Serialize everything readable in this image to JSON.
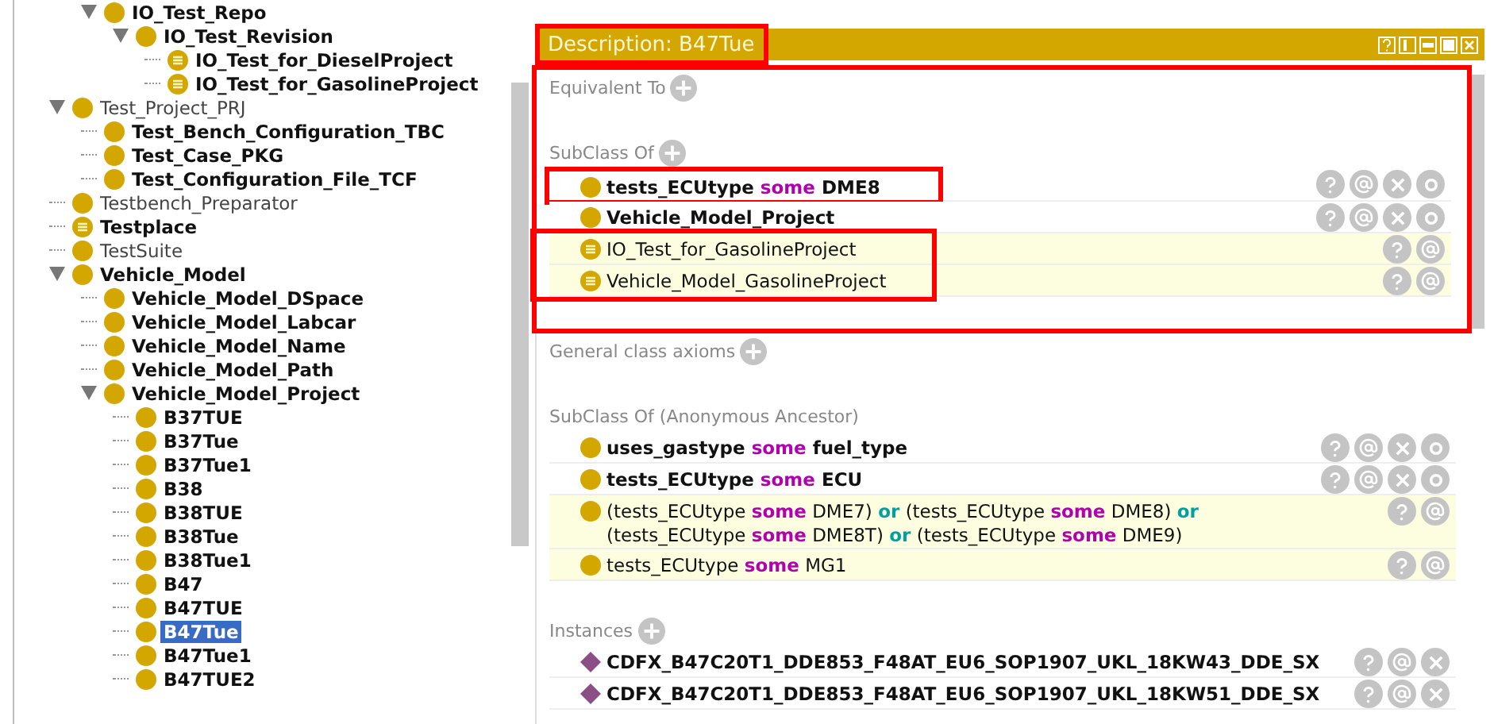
{
  "class_tree": {
    "continued_branch": [
      {
        "label": "IO_Test_Repo",
        "bold": true,
        "kind": "class",
        "expanded": true,
        "selected": false,
        "children": [
          {
            "label": "IO_Test_Revision",
            "bold": true,
            "kind": "class",
            "expanded": true,
            "selected": false,
            "children": [
              {
                "label": "IO_Test_for_DieselProject",
                "bold": true,
                "kind": "defined",
                "selected": false
              },
              {
                "label": "IO_Test_for_GasolineProject",
                "bold": true,
                "kind": "defined",
                "selected": false
              }
            ]
          }
        ]
      }
    ],
    "items": [
      {
        "label": "Test_Project_PRJ",
        "bold": false,
        "kind": "class",
        "expanded": true,
        "selected": false,
        "children": [
          {
            "label": "Test_Bench_Configuration_TBC",
            "bold": true,
            "kind": "class",
            "selected": false
          },
          {
            "label": "Test_Case_PKG",
            "bold": true,
            "kind": "class",
            "selected": false
          },
          {
            "label": "Test_Configuration_File_TCF",
            "bold": true,
            "kind": "class",
            "selected": false
          }
        ]
      },
      {
        "label": "Testbench_Preparator",
        "bold": false,
        "kind": "class",
        "selected": false
      },
      {
        "label": "Testplace",
        "bold": true,
        "kind": "defined",
        "selected": false
      },
      {
        "label": "TestSuite",
        "bold": false,
        "kind": "class",
        "selected": false
      },
      {
        "label": "Vehicle_Model",
        "bold": true,
        "kind": "class",
        "expanded": true,
        "selected": false,
        "children": [
          {
            "label": "Vehicle_Model_DSpace",
            "bold": true,
            "kind": "class",
            "selected": false
          },
          {
            "label": "Vehicle_Model_Labcar",
            "bold": true,
            "kind": "class",
            "selected": false
          },
          {
            "label": "Vehicle_Model_Name",
            "bold": true,
            "kind": "class",
            "selected": false
          },
          {
            "label": "Vehicle_Model_Path",
            "bold": true,
            "kind": "class",
            "selected": false
          },
          {
            "label": "Vehicle_Model_Project",
            "bold": true,
            "kind": "class",
            "expanded": true,
            "selected": false,
            "children": [
              {
                "label": "B37TUE",
                "bold": true,
                "kind": "class",
                "selected": false
              },
              {
                "label": "B37Tue",
                "bold": true,
                "kind": "class",
                "selected": false
              },
              {
                "label": "B37Tue1",
                "bold": true,
                "kind": "class",
                "selected": false
              },
              {
                "label": "B38",
                "bold": true,
                "kind": "class",
                "selected": false
              },
              {
                "label": "B38TUE",
                "bold": true,
                "kind": "class",
                "selected": false
              },
              {
                "label": "B38Tue",
                "bold": true,
                "kind": "class",
                "selected": false
              },
              {
                "label": "B38Tue1",
                "bold": true,
                "kind": "class",
                "selected": false
              },
              {
                "label": "B47",
                "bold": true,
                "kind": "class",
                "selected": false
              },
              {
                "label": "B47TUE",
                "bold": true,
                "kind": "class",
                "selected": false
              },
              {
                "label": "B47Tue",
                "bold": true,
                "kind": "class",
                "selected": true
              },
              {
                "label": "B47Tue1",
                "bold": true,
                "kind": "class",
                "selected": false
              },
              {
                "label": "B47TUE2",
                "bold": true,
                "kind": "class",
                "selected": false
              }
            ]
          }
        ]
      }
    ]
  },
  "description": {
    "title": "Description: B47Tue",
    "title_marked": true,
    "top_marked": true,
    "sections": [
      {
        "title": "Equivalent To",
        "add": true
      },
      {
        "title": "SubClass Of",
        "add": true,
        "rows": [
          {
            "kind": "asserted-class",
            "marked": true,
            "segments": [
              {
                "kind": "name",
                "text": "tests_ECUtype"
              },
              {
                "kind": "some",
                "text": "some"
              },
              {
                "kind": "name",
                "text": "DME8"
              }
            ]
          },
          {
            "kind": "asserted-class",
            "marked": false,
            "segments": [
              {
                "kind": "name",
                "text": "Vehicle_Model_Project"
              }
            ]
          },
          {
            "kind": "inferred-defined",
            "marked": true,
            "segments": [
              {
                "kind": "name",
                "text": "IO_Test_for_GasolineProject"
              }
            ]
          },
          {
            "kind": "inferred-defined",
            "marked": true,
            "segments": [
              {
                "kind": "name",
                "text": "Vehicle_Model_GasolineProject"
              }
            ]
          }
        ]
      },
      {
        "title": "General class axioms",
        "add": true
      },
      {
        "title": "SubClass Of (Anonymous Ancestor)",
        "rows": [
          {
            "kind": "asserted-class",
            "marked": false,
            "segments": [
              {
                "kind": "name",
                "text": "uses_gastype"
              },
              {
                "kind": "some",
                "text": "some"
              },
              {
                "kind": "name",
                "text": "fuel_type"
              }
            ]
          },
          {
            "kind": "asserted-class",
            "marked": false,
            "segments": [
              {
                "kind": "name",
                "text": "tests_ECUtype"
              },
              {
                "kind": "some",
                "text": "some"
              },
              {
                "kind": "name",
                "text": "ECU"
              }
            ]
          },
          {
            "kind": "inferred-class",
            "marked": false,
            "segments": [
              {
                "kind": "name",
                "text": "(tests_ECUtype"
              },
              {
                "kind": "some",
                "text": "some"
              },
              {
                "kind": "name",
                "text": "DME7)"
              },
              {
                "kind": "or",
                "text": "or"
              },
              {
                "kind": "name",
                "text": "(tests_ECUtype"
              },
              {
                "kind": "some",
                "text": "some"
              },
              {
                "kind": "name",
                "text": "DME8)"
              },
              {
                "kind": "or",
                "text": "or"
              },
              {
                "kind": "name",
                "text": "(tests_ECUtype"
              },
              {
                "kind": "some",
                "text": "some"
              },
              {
                "kind": "name",
                "text": "DME8T)"
              },
              {
                "kind": "or",
                "text": "or"
              },
              {
                "kind": "name",
                "text": "(tests_ECUtype"
              },
              {
                "kind": "some",
                "text": "some"
              },
              {
                "kind": "name",
                "text": "DME9)"
              }
            ]
          },
          {
            "kind": "inferred-class",
            "marked": false,
            "segments": [
              {
                "kind": "name",
                "text": "tests_ECUtype"
              },
              {
                "kind": "some",
                "text": "some"
              },
              {
                "kind": "name",
                "text": "MG1"
              }
            ]
          }
        ]
      },
      {
        "title": "Instances",
        "add": true,
        "rows": [
          {
            "kind": "instance",
            "marked": false,
            "segments": [
              {
                "kind": "name",
                "text": "CDFX_B47C20T1_DDE853_F48AT_EU6_SOP1907_UKL_18KW43_DDE_SX"
              }
            ]
          },
          {
            "kind": "instance",
            "marked": false,
            "segments": [
              {
                "kind": "name",
                "text": "CDFX_B47C20T1_DDE853_F48AT_EU6_SOP1907_UKL_18KW51_DDE_SX"
              }
            ]
          }
        ]
      }
    ]
  }
}
